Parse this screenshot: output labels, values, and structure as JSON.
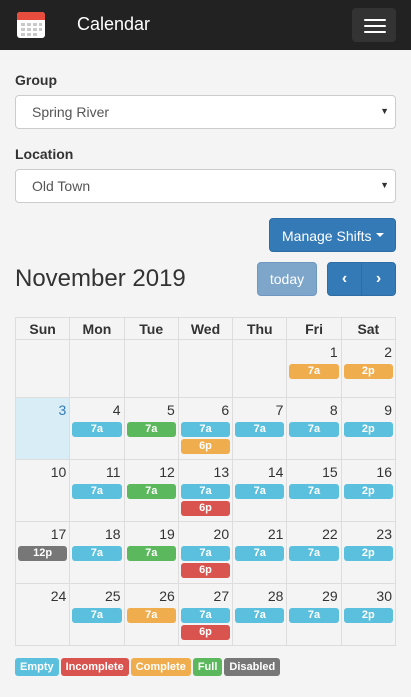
{
  "app": {
    "title": "Calendar",
    "icon": "calendar-icon",
    "menu_icon": "hamburger-menu-icon"
  },
  "form": {
    "group": {
      "label": "Group",
      "value": "Spring River"
    },
    "location": {
      "label": "Location",
      "value": "Old Town"
    },
    "dropdown_icon": "caret-down-icon"
  },
  "actions": {
    "manage_shifts": "Manage Shifts",
    "today": "today",
    "prev": "‹",
    "next": "›"
  },
  "calendar": {
    "month_label": "November 2019",
    "weekdays": [
      "Sun",
      "Mon",
      "Tue",
      "Wed",
      "Thu",
      "Fri",
      "Sat"
    ],
    "today": "3",
    "weeks": [
      [
        {
          "day": "",
          "events": []
        },
        {
          "day": "",
          "events": []
        },
        {
          "day": "",
          "events": []
        },
        {
          "day": "",
          "events": []
        },
        {
          "day": "",
          "events": []
        },
        {
          "day": "1",
          "events": [
            {
              "label": "7a",
              "status": "complete"
            }
          ]
        },
        {
          "day": "2",
          "events": [
            {
              "label": "2p",
              "status": "complete"
            }
          ]
        }
      ],
      [
        {
          "day": "3",
          "events": []
        },
        {
          "day": "4",
          "events": [
            {
              "label": "7a",
              "status": "empty"
            }
          ]
        },
        {
          "day": "5",
          "events": [
            {
              "label": "7a",
              "status": "full"
            }
          ]
        },
        {
          "day": "6",
          "events": [
            {
              "label": "7a",
              "status": "empty"
            },
            {
              "label": "6p",
              "status": "complete"
            }
          ]
        },
        {
          "day": "7",
          "events": [
            {
              "label": "7a",
              "status": "empty"
            }
          ]
        },
        {
          "day": "8",
          "events": [
            {
              "label": "7a",
              "status": "empty"
            }
          ]
        },
        {
          "day": "9",
          "events": [
            {
              "label": "2p",
              "status": "empty"
            }
          ]
        }
      ],
      [
        {
          "day": "10",
          "events": []
        },
        {
          "day": "11",
          "events": [
            {
              "label": "7a",
              "status": "empty"
            }
          ]
        },
        {
          "day": "12",
          "events": [
            {
              "label": "7a",
              "status": "full"
            }
          ]
        },
        {
          "day": "13",
          "events": [
            {
              "label": "7a",
              "status": "empty"
            },
            {
              "label": "6p",
              "status": "incomplete"
            }
          ]
        },
        {
          "day": "14",
          "events": [
            {
              "label": "7a",
              "status": "empty"
            }
          ]
        },
        {
          "day": "15",
          "events": [
            {
              "label": "7a",
              "status": "empty"
            }
          ]
        },
        {
          "day": "16",
          "events": [
            {
              "label": "2p",
              "status": "empty"
            }
          ]
        }
      ],
      [
        {
          "day": "17",
          "events": [
            {
              "label": "12p",
              "status": "disabled"
            }
          ]
        },
        {
          "day": "18",
          "events": [
            {
              "label": "7a",
              "status": "empty"
            }
          ]
        },
        {
          "day": "19",
          "events": [
            {
              "label": "7a",
              "status": "full"
            }
          ]
        },
        {
          "day": "20",
          "events": [
            {
              "label": "7a",
              "status": "empty"
            },
            {
              "label": "6p",
              "status": "incomplete"
            }
          ]
        },
        {
          "day": "21",
          "events": [
            {
              "label": "7a",
              "status": "empty"
            }
          ]
        },
        {
          "day": "22",
          "events": [
            {
              "label": "7a",
              "status": "empty"
            }
          ]
        },
        {
          "day": "23",
          "events": [
            {
              "label": "2p",
              "status": "empty"
            }
          ]
        }
      ],
      [
        {
          "day": "24",
          "events": []
        },
        {
          "day": "25",
          "events": [
            {
              "label": "7a",
              "status": "empty"
            }
          ]
        },
        {
          "day": "26",
          "events": [
            {
              "label": "7a",
              "status": "complete"
            }
          ]
        },
        {
          "day": "27",
          "events": [
            {
              "label": "7a",
              "status": "empty"
            },
            {
              "label": "6p",
              "status": "incomplete"
            }
          ]
        },
        {
          "day": "28",
          "events": [
            {
              "label": "7a",
              "status": "empty"
            }
          ]
        },
        {
          "day": "29",
          "events": [
            {
              "label": "7a",
              "status": "empty"
            }
          ]
        },
        {
          "day": "30",
          "events": [
            {
              "label": "2p",
              "status": "empty"
            }
          ]
        }
      ]
    ]
  },
  "legend": [
    {
      "label": "Empty",
      "status": "empty"
    },
    {
      "label": "Incomplete",
      "status": "incomplete"
    },
    {
      "label": "Complete",
      "status": "complete"
    },
    {
      "label": "Full",
      "status": "full"
    },
    {
      "label": "Disabled",
      "status": "disabled"
    }
  ],
  "status_colors": {
    "empty": "#5bc0de",
    "incomplete": "#d9534f",
    "complete": "#f0ad4e",
    "full": "#5cb85c",
    "disabled": "#777777"
  }
}
